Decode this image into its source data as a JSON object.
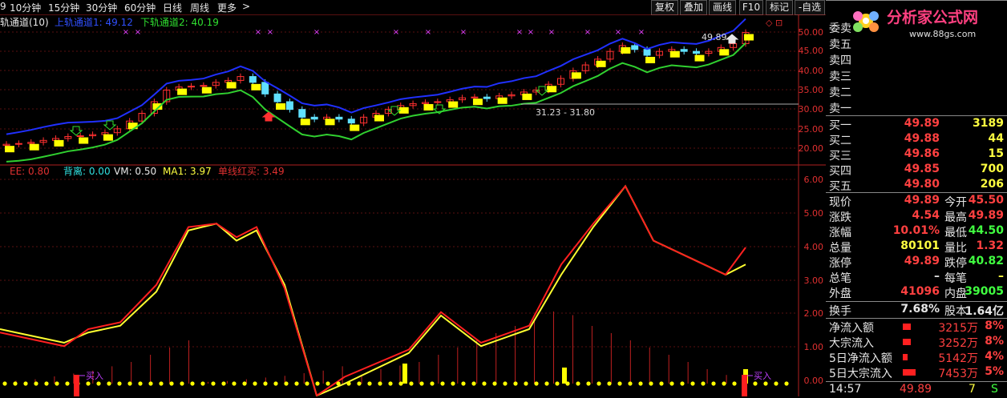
{
  "toolbar": {
    "periods": [
      "10分钟",
      "15分钟",
      "30分钟",
      "60分钟",
      "日线",
      "周线",
      "更多"
    ],
    "partial": "9",
    "buttons": [
      "复权",
      "叠加",
      "画线",
      "F10",
      "标记",
      "-自选"
    ]
  },
  "upper_chart": {
    "indicator_name": "轨通道(10)",
    "upper_label": "上轨通道1: 49.12",
    "lower_label": "下轨通道2: 40.19",
    "y_ticks": [
      "50.00",
      "45.00",
      "40.00",
      "35.00",
      "30.00",
      "25.00",
      "20.00"
    ],
    "annotation_high": "49.89",
    "annotation_range": "31.23 - 31.80",
    "markers": "◇ ⊡"
  },
  "lower_chart": {
    "labels": [
      "EE: 0.80",
      "背离: 0.00",
      "VM: 0.50",
      "MA1: 3.97",
      "单线红买: 3.49"
    ],
    "y_ticks": [
      "6.00",
      "5.00",
      "4.00",
      "3.00",
      "2.00",
      "1.00",
      "0.00"
    ],
    "buy_label_1": "买入",
    "buy_label_2": "买入"
  },
  "chart_data": {
    "type": "line",
    "series": [
      {
        "name": "EE",
        "values": [
          1.5,
          1.3,
          1.1,
          1.6,
          1.8,
          2.9,
          4.6,
          4.7,
          4.3,
          4.6,
          2.8,
          -1.0,
          0.2,
          1.0,
          2.1,
          1.2,
          1.7,
          3.5,
          4.7,
          5.8,
          4.2,
          3.2,
          4.0
        ]
      },
      {
        "name": "MA1",
        "values": [
          1.6,
          1.4,
          1.2,
          1.5,
          1.7,
          2.7,
          4.5,
          4.7,
          4.2,
          4.5,
          2.9,
          -0.5,
          0.0,
          0.9,
          2.0,
          1.1,
          1.6,
          3.2,
          4.6,
          5.8,
          4.2,
          3.2,
          3.5
        ]
      }
    ],
    "ylim": [
      0,
      6
    ]
  },
  "quote_panel": {
    "asks": [
      {
        "label": "委卖",
        "price": "",
        "vol": ""
      },
      {
        "label": "卖五",
        "price": "",
        "vol": ""
      },
      {
        "label": "卖四",
        "price": "",
        "vol": ""
      },
      {
        "label": "卖三",
        "price": "",
        "vol": ""
      },
      {
        "label": "卖二",
        "price": "",
        "vol": ""
      },
      {
        "label": "卖一",
        "price": "",
        "vol": ""
      }
    ],
    "bids": [
      {
        "label": "买一",
        "price": "49.89",
        "vol": "3189"
      },
      {
        "label": "买二",
        "price": "49.88",
        "vol": "44"
      },
      {
        "label": "买三",
        "price": "49.86",
        "vol": "15"
      },
      {
        "label": "买四",
        "price": "49.85",
        "vol": "700"
      },
      {
        "label": "买五",
        "price": "49.80",
        "vol": "206"
      }
    ],
    "stats": [
      {
        "l1": "现价",
        "v1": "49.89",
        "c1": "red",
        "l2": "今开",
        "v2": "45.50",
        "c2": "red"
      },
      {
        "l1": "涨跌",
        "v1": "4.54",
        "c1": "red",
        "l2": "最高",
        "v2": "49.89",
        "c2": "red"
      },
      {
        "l1": "涨幅",
        "v1": "10.01%",
        "c1": "red",
        "l2": "最低",
        "v2": "44.50",
        "c2": "green"
      },
      {
        "l1": "总量",
        "v1": "80101",
        "c1": "yellow",
        "l2": "量比",
        "v2": "1.32",
        "c2": "red"
      },
      {
        "l1": "涨停",
        "v1": "49.89",
        "c1": "red",
        "l2": "跌停",
        "v2": "40.82",
        "c2": "green"
      },
      {
        "l1": "总笔",
        "v1": "–",
        "c1": "",
        "l2": "每笔",
        "v2": "–",
        "c2": ""
      },
      {
        "l1": "外盘",
        "v1": "41096",
        "c1": "red",
        "l2": "内盘",
        "v2": "39005",
        "c2": "green"
      }
    ],
    "turnover": {
      "label": "换手",
      "value": "7.68%",
      "label2": "股本",
      "value2": "1.64亿"
    },
    "flows": [
      {
        "label": "净流入额",
        "amount": "3215万",
        "pct": "8%"
      },
      {
        "label": "大宗流入",
        "amount": "3252万",
        "pct": "8%"
      },
      {
        "label": "5日净流入额",
        "amount": "5142万",
        "pct": "4%"
      },
      {
        "label": "5日大宗流入",
        "amount": "7453万",
        "pct": "5%"
      }
    ],
    "tick": {
      "time": "14:57",
      "price": "49.89",
      "vol": "7",
      "dir": "S"
    }
  },
  "logo": {
    "text": "分析家公式网",
    "url": "www.88gs.com"
  },
  "colors": {
    "red": "#ff3030",
    "green": "#30e030",
    "blue": "#2030ff",
    "yellow": "#ffff00",
    "cyan": "#60e0ff"
  }
}
